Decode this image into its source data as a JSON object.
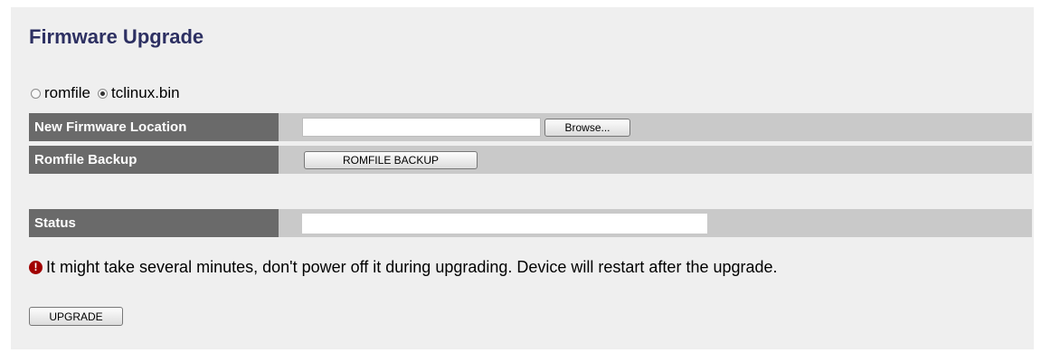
{
  "page": {
    "title": "Firmware Upgrade"
  },
  "file_type": {
    "options": [
      {
        "label": "romfile",
        "selected": false
      },
      {
        "label": "tclinux.bin",
        "selected": true
      }
    ]
  },
  "rows": {
    "firmware_location": {
      "label": "New Firmware Location",
      "input_value": "",
      "browse_label": "Browse..."
    },
    "romfile_backup": {
      "label": "Romfile Backup",
      "button_label": "ROMFILE BACKUP"
    },
    "status": {
      "label": "Status",
      "value": ""
    }
  },
  "warning": {
    "icon": "exclamation-icon",
    "text": "It might take several minutes, don't power off it during upgrading. Device will restart after the upgrade."
  },
  "actions": {
    "upgrade_label": "UPGRADE"
  },
  "colors": {
    "title": "#2d3062",
    "label_bg": "#6a6a6a",
    "row_bg": "#c9c9c9",
    "panel_bg": "#efefef",
    "warning_icon": "#a10000"
  }
}
